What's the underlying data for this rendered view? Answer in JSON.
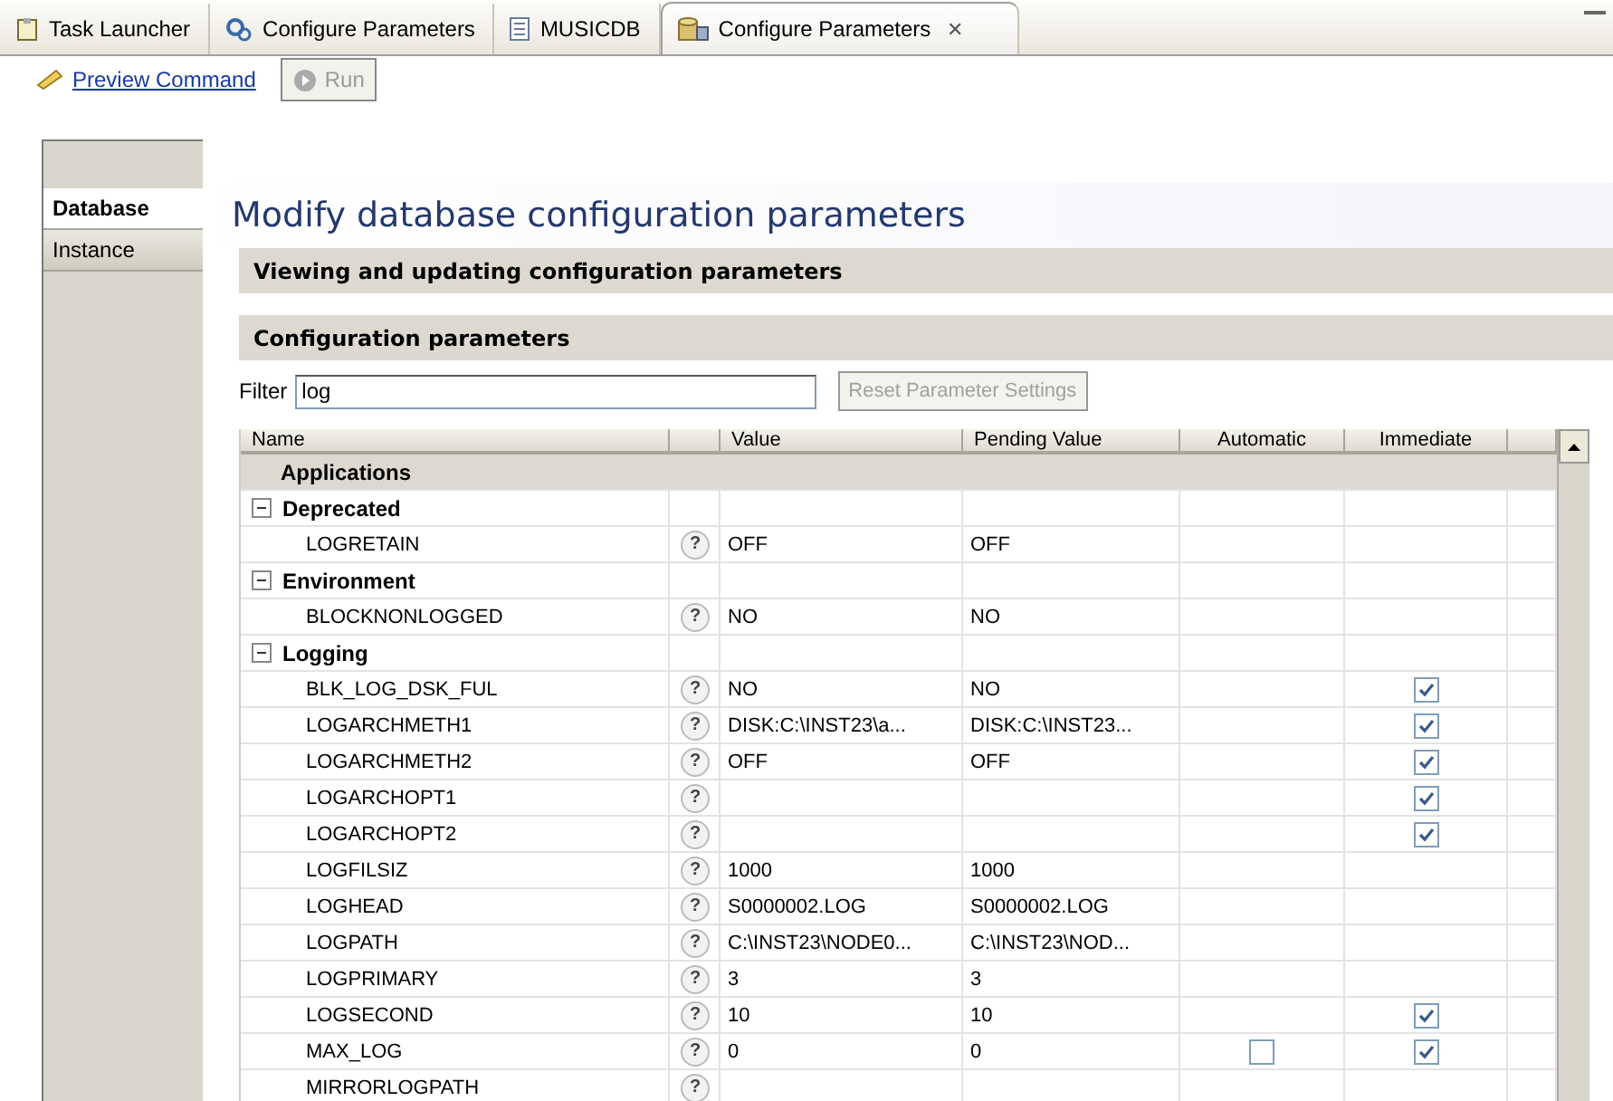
{
  "editor_tabs": [
    {
      "label": "Task Launcher",
      "selected": false
    },
    {
      "label": "Configure Parameters",
      "selected": false
    },
    {
      "label": "MUSICDB",
      "selected": false
    },
    {
      "label": "Configure Parameters",
      "selected": true,
      "close": "✕"
    }
  ],
  "toolbar": {
    "preview_link": "Preview Command",
    "run_button": {
      "label": "Run",
      "disabled": true
    }
  },
  "sidebar": {
    "items": [
      {
        "label": "Database",
        "selected": true
      },
      {
        "label": "Instance",
        "selected": false
      }
    ]
  },
  "page_title": "Modify database configuration parameters",
  "sections": [
    "Viewing and updating configuration parameters",
    "Configuration parameters"
  ],
  "filter": {
    "label": "Filter",
    "value": "log",
    "reset_button": {
      "label": "Reset Parameter Settings",
      "disabled": true
    }
  },
  "table": {
    "columns": [
      "Name",
      "Value",
      "Pending Value",
      "Automatic",
      "Immediate"
    ],
    "rows": [
      {
        "kind": "category",
        "name": "Applications"
      },
      {
        "kind": "group",
        "name": "Deprecated",
        "expanded": true
      },
      {
        "kind": "param",
        "name": "LOGRETAIN",
        "help": "?",
        "value": "OFF",
        "pending": "OFF"
      },
      {
        "kind": "group",
        "name": "Environment",
        "expanded": true
      },
      {
        "kind": "param",
        "name": "BLOCKNONLOGGED",
        "help": "?",
        "value": "NO",
        "pending": "NO"
      },
      {
        "kind": "group",
        "name": "Logging",
        "expanded": true
      },
      {
        "kind": "param",
        "name": "BLK_LOG_DSK_FUL",
        "help": "?",
        "value": "NO",
        "pending": "NO",
        "immediate": true
      },
      {
        "kind": "param",
        "name": "LOGARCHMETH1",
        "help": "?",
        "value": "DISK:C:\\INST23\\a...",
        "pending": "DISK:C:\\INST23...",
        "immediate": true
      },
      {
        "kind": "param",
        "name": "LOGARCHMETH2",
        "help": "?",
        "value": "OFF",
        "pending": "OFF",
        "immediate": true
      },
      {
        "kind": "param",
        "name": "LOGARCHOPT1",
        "help": "?",
        "immediate": true
      },
      {
        "kind": "param",
        "name": "LOGARCHOPT2",
        "help": "?",
        "immediate": true
      },
      {
        "kind": "param",
        "name": "LOGFILSIZ",
        "help": "?",
        "value": "1000",
        "pending": "1000"
      },
      {
        "kind": "param",
        "name": "LOGHEAD",
        "help": "?",
        "value": "S0000002.LOG",
        "pending": "S0000002.LOG"
      },
      {
        "kind": "param",
        "name": "LOGPATH",
        "help": "?",
        "value": "C:\\INST23\\NODE0...",
        "pending": "C:\\INST23\\NOD..."
      },
      {
        "kind": "param",
        "name": "LOGPRIMARY",
        "help": "?",
        "value": "3",
        "pending": "3"
      },
      {
        "kind": "param",
        "name": "LOGSECOND",
        "help": "?",
        "value": "10",
        "pending": "10",
        "immediate": true
      },
      {
        "kind": "param",
        "name": "MAX_LOG",
        "help": "?",
        "value": "0",
        "pending": "0",
        "automatic": false,
        "immediate": true
      },
      {
        "kind": "param",
        "name": "MIRRORLOGPATH",
        "help": "?"
      }
    ]
  }
}
